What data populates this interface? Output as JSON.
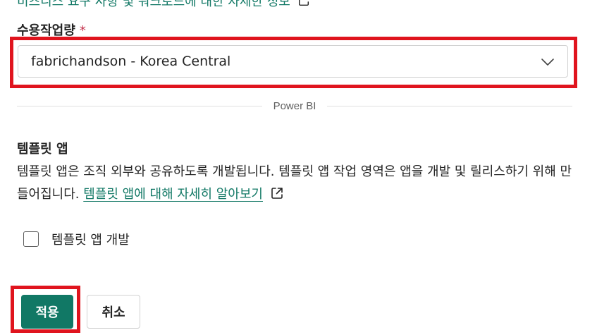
{
  "top": {
    "link_text": "비즈니스 요구 사항 및 워크로드에 대한 자세한 정보"
  },
  "capacity": {
    "label": "수용작업량",
    "required_mark": "*",
    "selected_value": "fabrichandson - Korea Central"
  },
  "divider": {
    "label": "Power BI"
  },
  "template_app": {
    "title": "템플릿 앱",
    "description": "템플릿 앱은 조직 외부와 공유하도록 개발됩니다. 템플릿 앱 작업 영역은 앱을 개발 및 릴리스하기 위해 만들어집니다.",
    "learn_more_link": "템플릿 앱에 대해 자세히 알아보기",
    "checkbox_label": "템플릿 앱 개발"
  },
  "actions": {
    "apply_label": "적용",
    "cancel_label": "취소"
  },
  "colors": {
    "accent": "#117865",
    "highlight": "#e0141e",
    "required": "#c4314b"
  }
}
